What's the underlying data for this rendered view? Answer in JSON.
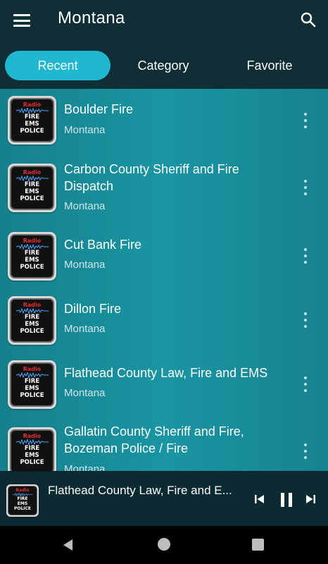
{
  "app_bar": {
    "title": "Montana",
    "menu_icon": "hamburger-menu-icon",
    "search_icon": "search-icon"
  },
  "tabs": [
    {
      "label": "Recent",
      "active": true
    },
    {
      "label": "Category",
      "active": false
    },
    {
      "label": "Favorite",
      "active": false
    }
  ],
  "thumbnail": {
    "radio": "Radio",
    "line1": "FIRE",
    "line2": "EMS",
    "line3": "POLICE"
  },
  "stations": [
    {
      "title": "Boulder Fire",
      "subtitle": "Montana"
    },
    {
      "title": "Carbon County Sheriff and Fire Dispatch",
      "subtitle": "Montana"
    },
    {
      "title": "Cut Bank Fire",
      "subtitle": "Montana"
    },
    {
      "title": "Dillon Fire",
      "subtitle": "Montana"
    },
    {
      "title": "Flathead County Law, Fire and EMS",
      "subtitle": "Montana"
    },
    {
      "title": "Gallatin County Sheriff and Fire, Bozeman Police / Fire",
      "subtitle": "Montana"
    }
  ],
  "player": {
    "now_playing": "Flathead County Law, Fire and E...",
    "state": "playing"
  },
  "colors": {
    "accent": "#1fb8d0",
    "list_bg": "#1a95a3",
    "app_bar_bg": "#0f2e35"
  }
}
